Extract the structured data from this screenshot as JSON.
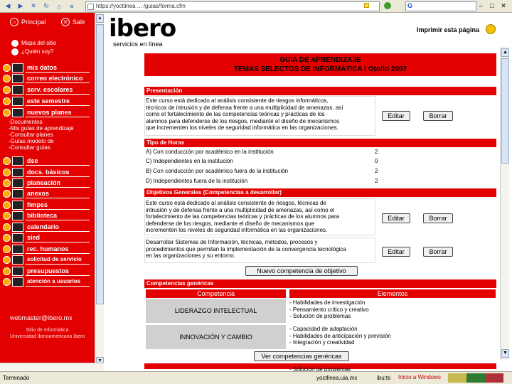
{
  "browser": {
    "address": "https://yoctlinea ... /guias/forma.cfm",
    "search_icon": "G"
  },
  "sidebar": {
    "principal": "Principal",
    "salir": "Salir",
    "links": [
      "Mapa del sitio",
      "¿Quién soy?"
    ],
    "menu": [
      {
        "label": "mis datos",
        "icon": "user-card-icon"
      },
      {
        "label": "correo electrónico",
        "icon": "mail-icon"
      },
      {
        "label": "serv. escolares",
        "icon": "school-icon"
      },
      {
        "label": "este semestre",
        "icon": "calendar-icon"
      },
      {
        "label": "nuevos planes",
        "icon": "plans-icon"
      }
    ],
    "submenu": [
      "-Documentos",
      "-Mis guías de aprendizaje",
      "-Consultar planes",
      "-Guías modelo de",
      "-Consultar guías"
    ],
    "menu2": [
      {
        "label": "dse",
        "icon": "dse-icon"
      },
      {
        "label": "docs. básicos",
        "icon": "docs-icon"
      },
      {
        "label": "planeación",
        "icon": "planning-icon"
      },
      {
        "label": "anexos",
        "icon": "annex-icon"
      },
      {
        "label": "fimpes",
        "icon": "fimpes-icon"
      },
      {
        "label": "biblioteca",
        "icon": "library-icon"
      },
      {
        "label": "calendario",
        "icon": "calendar-icon"
      },
      {
        "label": "sied",
        "icon": "sied-icon"
      },
      {
        "label": "rec. humanos",
        "icon": "hr-icon"
      },
      {
        "label": "solicitud de servicio",
        "icon": "service-icon"
      },
      {
        "label": "presupuestos",
        "icon": "budget-icon"
      },
      {
        "label": "atención a usuarios",
        "icon": "users-icon"
      }
    ],
    "webmaster": "webmaster@ibero.mx",
    "footer1": "Sitio de Informática",
    "footer2": "Universidad Iberoamericana Ibero"
  },
  "header": {
    "logo": "ibero",
    "logo_sub": "servicios en línea",
    "print": "Imprimir esta página"
  },
  "guide": {
    "title1": "GUIA DE APRENDIZAJE",
    "title2": "TEMAS SELECTOS DE INFORMÁTICA I   Otoño 2007"
  },
  "presentacion": {
    "head": "Presentación",
    "lines": [
      "Este curso está dedicado al análisis consistente de riesgos informáticos,",
      "técnicos de intrusión y de defensa frente a una multiplicidad de amenazas, así",
      "como el fortalecimiento de las competencias teóricas y prácticas de los",
      "alumnos para defenderse de los riesgos, mediante el diseño de mecanismos",
      "que incrementen los niveles de seguridad informática en las organizaciones."
    ],
    "edit": "Editar",
    "delete": "Borrar"
  },
  "horas": {
    "head": "Tipo de Horas",
    "rows": [
      {
        "label": "A) Con conducción por académico en la institución",
        "value": "2"
      },
      {
        "label": "C) Independientes en la institución",
        "value": "0"
      },
      {
        "label": "B) Con conducción por académico fuera de la institución",
        "value": "2"
      },
      {
        "label": "D) Independientes fuera de la institución",
        "value": "2"
      }
    ]
  },
  "objetivos": {
    "head": "Objetivos Generales (Competencias a desarrollar)",
    "items": [
      [
        "Este curso está dedicado al análisis consistente de riesgos, técnicas de",
        "intrusión y de defensa frente a una multiplicidad de amenazas, así como el",
        "fortalecimiento de las competencias teóricas y prácticas de los alumnos para",
        "defenderse de los riesgos, mediante el diseño de mecanismos que",
        "incrementen los niveles de seguridad informática en las organizaciones."
      ],
      [
        "Desarrollar Sistemas de Información, técnicas, métodos, procesos y",
        "procedimientos que permitan la implementación de la convergencia tecnológica",
        "en las organizaciones y su entorno."
      ]
    ],
    "edit": "Editar",
    "delete": "Borrar",
    "new_button": "Nuevo competencia de objetivo"
  },
  "competencias": {
    "head": "Competencias genéricas",
    "col1": "Competencia",
    "col2": "Elementos",
    "rows": [
      {
        "name": "LIDERAZGO INTELECTUAL",
        "elements": [
          "- Habilidades de investigación",
          "- Pensamiento crítico y creativo",
          "- Solución de problemas"
        ]
      },
      {
        "name": "INNOVACIÓN Y CAMBIO",
        "elements": [
          "- Capacidad de adaptación",
          "- Habilidades de anticipación y previsión",
          "- Integración y creatividad"
        ]
      }
    ],
    "see_button": "Ver competencias genéricas",
    "trailing": "- Solución de problemas"
  },
  "status": {
    "text": "Terminado",
    "host": "yoctlinea.uia.mx",
    "time": "ibu:ts",
    "red": "Inicio a Windows"
  }
}
